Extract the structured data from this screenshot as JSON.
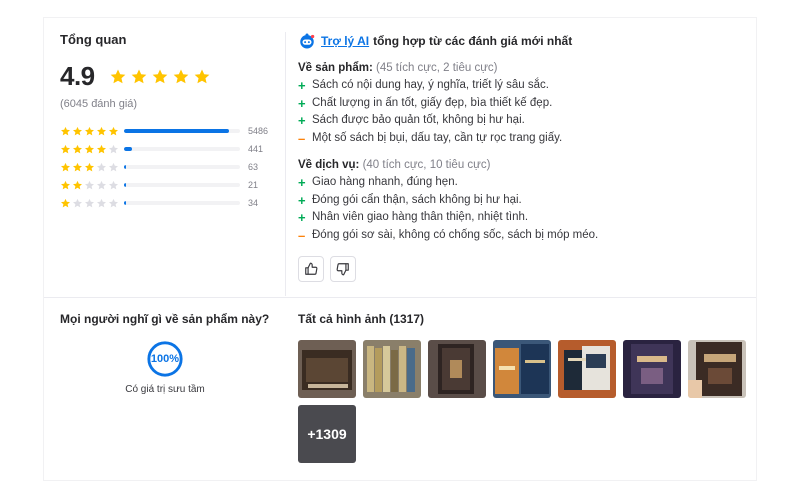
{
  "overview": {
    "title": "Tổng quan",
    "score": "4.9",
    "review_count": "(6045 đánh giá)",
    "star_rating": 4.9,
    "distribution": [
      {
        "stars": 5,
        "count": "5486",
        "fill": 0.907
      },
      {
        "stars": 4,
        "count": "441",
        "fill": 0.073
      },
      {
        "stars": 3,
        "count": "63",
        "fill": 0.01
      },
      {
        "stars": 2,
        "count": "21",
        "fill": 0.004
      },
      {
        "stars": 1,
        "count": "34",
        "fill": 0.006
      }
    ],
    "star_color": "#ffc400",
    "bar_color": "#0b74e5"
  },
  "ai_summary": {
    "link_label": "Trợ lý AI",
    "heading_rest": "tổng hợp từ các đánh giá mới nhất",
    "product": {
      "label": "Về sản phẩm:",
      "sub": "(45 tích cực, 2 tiêu cực)",
      "items": [
        {
          "type": "plus",
          "text": "Sách có nội dung hay, ý nghĩa, triết lý sâu sắc."
        },
        {
          "type": "plus",
          "text": "Chất lượng in ấn tốt, giấy đẹp, bìa thiết kế đẹp."
        },
        {
          "type": "plus",
          "text": "Sách được bảo quản tốt, không bị hư hại."
        },
        {
          "type": "minus",
          "text": "Một số sách bị bụi, dấu tay, cần tự rọc trang giấy."
        }
      ]
    },
    "service": {
      "label": "Về dịch vụ:",
      "sub": "(40 tích cực, 10 tiêu cực)",
      "items": [
        {
          "type": "plus",
          "text": "Giao hàng nhanh, đúng hẹn."
        },
        {
          "type": "plus",
          "text": "Đóng gói cẩn thận, sách không bị hư hại."
        },
        {
          "type": "plus",
          "text": "Nhân viên giao hàng thân thiện, nhiệt tình."
        },
        {
          "type": "minus",
          "text": "Đóng gói sơ sài, không có chống sốc, sách bị móp méo."
        }
      ]
    },
    "icons": {
      "like": "thumbs-up-icon",
      "dislike": "thumbs-down-icon"
    }
  },
  "opinion": {
    "title": "Mọi người nghĩ gì về sản phẩm này?",
    "percent": "100%",
    "percent_value": 1.0,
    "label": "Có giá trị sưu tầm"
  },
  "photos": {
    "title": "Tất cả hình ảnh (1317)",
    "more_label": "+1309"
  }
}
